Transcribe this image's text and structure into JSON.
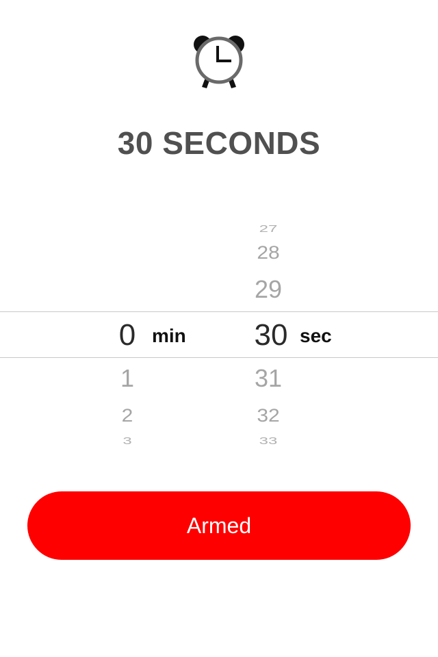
{
  "header": {
    "icon": "alarm-clock-icon",
    "title": "30 SECONDS"
  },
  "picker": {
    "minutes": {
      "unit_label": "min",
      "selected": "0",
      "rows_after": [
        "1",
        "2",
        "3"
      ]
    },
    "seconds": {
      "unit_label": "sec",
      "selected": "30",
      "rows_before": [
        "27",
        "28",
        "29"
      ],
      "rows_after": [
        "31",
        "32",
        "33"
      ]
    }
  },
  "button": {
    "label": "Armed",
    "color": "#ff0000"
  },
  "colors": {
    "title": "#505050",
    "wheel_inactive": "#a5a5a5",
    "wheel_selected": "#2a2a2a",
    "divider": "#c8c8c8"
  }
}
